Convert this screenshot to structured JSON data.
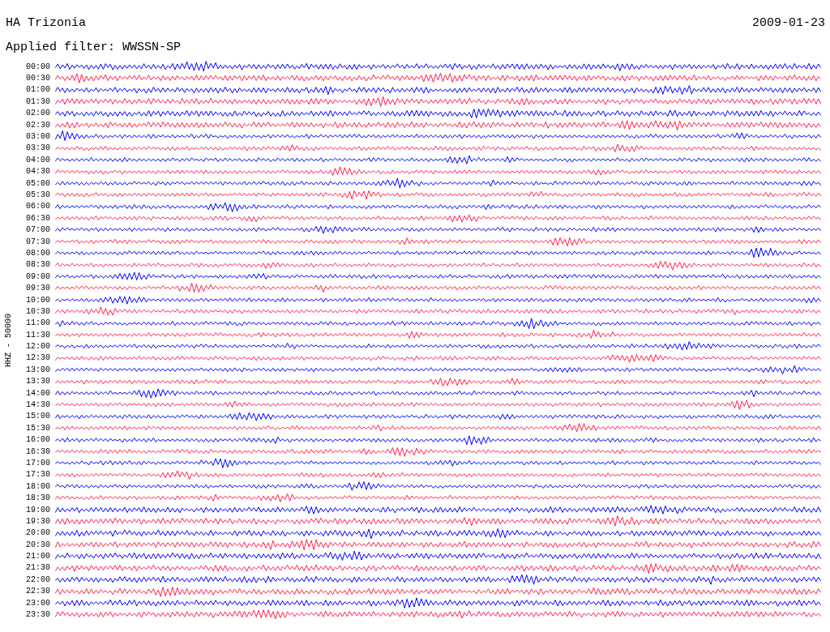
{
  "station": "HA Trizonia",
  "date": "2009-01-23",
  "filter_label": "Applied filter: WWSSN-SP",
  "axis_label": "HHZ - 50000",
  "traces": [
    {
      "time": "00:00",
      "color": "#0000ff"
    },
    {
      "time": "00:30",
      "color": "#ff2050"
    },
    {
      "time": "01:00",
      "color": "#0000ff"
    },
    {
      "time": "01:30",
      "color": "#ff2050"
    },
    {
      "time": "02:00",
      "color": "#0000ff"
    },
    {
      "time": "02:30",
      "color": "#ff2050"
    },
    {
      "time": "03:00",
      "color": "#0000ff"
    },
    {
      "time": "03:30",
      "color": "#ff2050"
    },
    {
      "time": "04:00",
      "color": "#0000ff"
    },
    {
      "time": "04:30",
      "color": "#ff2050"
    },
    {
      "time": "05:00",
      "color": "#0000ff"
    },
    {
      "time": "05:30",
      "color": "#ff2050"
    },
    {
      "time": "06:00",
      "color": "#0000ff"
    },
    {
      "time": "06:30",
      "color": "#ff2050"
    },
    {
      "time": "07:00",
      "color": "#0000ff"
    },
    {
      "time": "07:30",
      "color": "#ff2050"
    },
    {
      "time": "08:00",
      "color": "#0000ff"
    },
    {
      "time": "08:30",
      "color": "#ff2050"
    },
    {
      "time": "09:00",
      "color": "#0000ff"
    },
    {
      "time": "09:30",
      "color": "#ff2050"
    },
    {
      "time": "10:00",
      "color": "#0000ff"
    },
    {
      "time": "10:30",
      "color": "#ff2050"
    },
    {
      "time": "11:00",
      "color": "#0000ff"
    },
    {
      "time": "11:30",
      "color": "#ff2050"
    },
    {
      "time": "12:00",
      "color": "#0000ff"
    },
    {
      "time": "12:30",
      "color": "#ff2050"
    },
    {
      "time": "13:00",
      "color": "#0000ff"
    },
    {
      "time": "13:30",
      "color": "#ff2050"
    },
    {
      "time": "14:00",
      "color": "#0000ff"
    },
    {
      "time": "14:30",
      "color": "#ff2050"
    },
    {
      "time": "15:00",
      "color": "#0000ff"
    },
    {
      "time": "15:30",
      "color": "#ff2050"
    },
    {
      "time": "16:00",
      "color": "#0000ff"
    },
    {
      "time": "16:30",
      "color": "#ff2050"
    },
    {
      "time": "17:00",
      "color": "#0000ff"
    },
    {
      "time": "17:30",
      "color": "#ff2050"
    },
    {
      "time": "18:00",
      "color": "#0000ff"
    },
    {
      "time": "18:30",
      "color": "#ff2050"
    },
    {
      "time": "19:00",
      "color": "#0000ff"
    },
    {
      "time": "19:30",
      "color": "#ff2050"
    },
    {
      "time": "20:00",
      "color": "#0000ff"
    },
    {
      "time": "20:30",
      "color": "#ff2050"
    },
    {
      "time": "21:00",
      "color": "#0000ff"
    },
    {
      "time": "21:30",
      "color": "#ff2050"
    },
    {
      "time": "22:00",
      "color": "#0000ff"
    },
    {
      "time": "22:30",
      "color": "#ff2050"
    },
    {
      "time": "23:00",
      "color": "#0000ff"
    },
    {
      "time": "23:30",
      "color": "#ff2050"
    }
  ]
}
